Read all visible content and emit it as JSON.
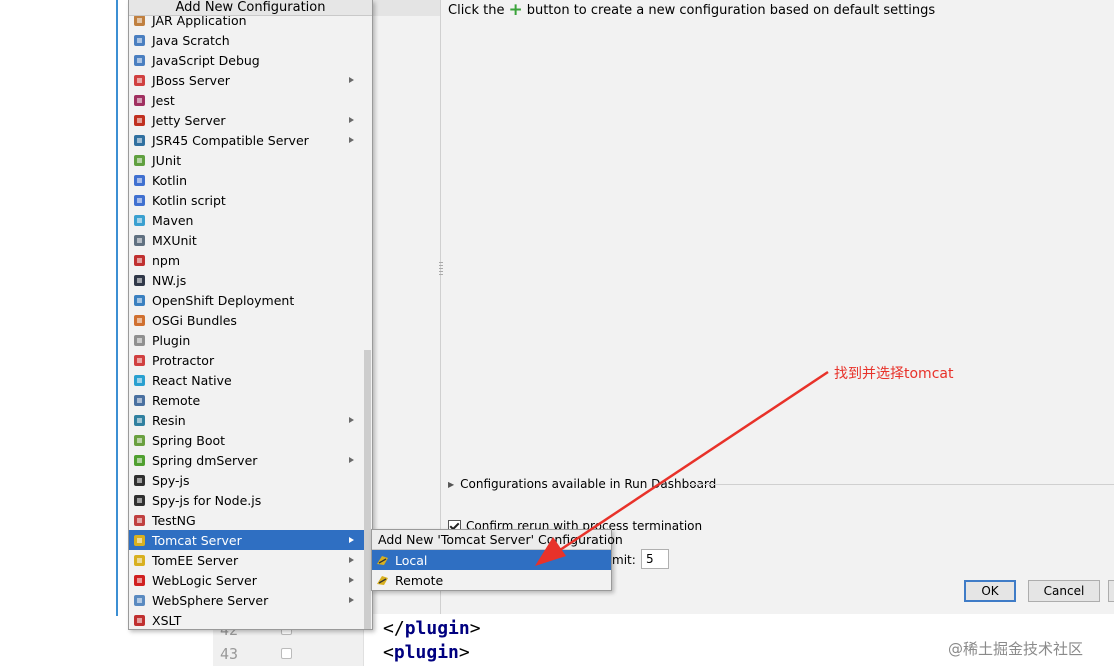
{
  "popup": {
    "title": "Add New Configuration",
    "items": [
      {
        "label": "JAR Application",
        "icon": "jar-icon",
        "color": "#c08040",
        "submenu": false
      },
      {
        "label": "Java Scratch",
        "icon": "scratch-icon",
        "color": "#4a7fc0",
        "submenu": false
      },
      {
        "label": "JavaScript Debug",
        "icon": "js-debug-icon",
        "color": "#4a7fc0",
        "submenu": false
      },
      {
        "label": "JBoss Server",
        "icon": "jboss-icon",
        "color": "#d04040",
        "submenu": true
      },
      {
        "label": "Jest",
        "icon": "jest-icon",
        "color": "#a03060",
        "submenu": false
      },
      {
        "label": "Jetty Server",
        "icon": "jetty-icon",
        "color": "#c03020",
        "submenu": true
      },
      {
        "label": "JSR45 Compatible Server",
        "icon": "jsr45-icon",
        "color": "#3070a0",
        "submenu": true
      },
      {
        "label": "JUnit",
        "icon": "junit-icon",
        "color": "#60a040",
        "submenu": false
      },
      {
        "label": "Kotlin",
        "icon": "kotlin-icon",
        "color": "#4070d0",
        "submenu": false
      },
      {
        "label": "Kotlin script",
        "icon": "kotlin-script-icon",
        "color": "#4070d0",
        "submenu": false
      },
      {
        "label": "Maven",
        "icon": "maven-icon",
        "color": "#3aa0d0",
        "submenu": false
      },
      {
        "label": "MXUnit",
        "icon": "mxunit-icon",
        "color": "#607080",
        "submenu": false
      },
      {
        "label": "npm",
        "icon": "npm-icon",
        "color": "#c03030",
        "submenu": false
      },
      {
        "label": "NW.js",
        "icon": "nwjs-icon",
        "color": "#303848",
        "submenu": false
      },
      {
        "label": "OpenShift Deployment",
        "icon": "openshift-icon",
        "color": "#3a80c0",
        "submenu": false
      },
      {
        "label": "OSGi Bundles",
        "icon": "osgi-icon",
        "color": "#d07030",
        "submenu": false
      },
      {
        "label": "Plugin",
        "icon": "plugin-icon",
        "color": "#909090",
        "submenu": false
      },
      {
        "label": "Protractor",
        "icon": "protractor-icon",
        "color": "#d04040",
        "submenu": false
      },
      {
        "label": "React Native",
        "icon": "react-icon",
        "color": "#2aa0d0",
        "submenu": false
      },
      {
        "label": "Remote",
        "icon": "remote-icon",
        "color": "#4a70a0",
        "submenu": false
      },
      {
        "label": "Resin",
        "icon": "resin-icon",
        "color": "#3080a0",
        "submenu": true
      },
      {
        "label": "Spring Boot",
        "icon": "spring-boot-icon",
        "color": "#6aa040",
        "submenu": false
      },
      {
        "label": "Spring dmServer",
        "icon": "spring-dm-icon",
        "color": "#50a030",
        "submenu": true
      },
      {
        "label": "Spy-js",
        "icon": "spyjs-icon",
        "color": "#303030",
        "submenu": false
      },
      {
        "label": "Spy-js for Node.js",
        "icon": "spyjs-node-icon",
        "color": "#303030",
        "submenu": false
      },
      {
        "label": "TestNG",
        "icon": "testng-icon",
        "color": "#c04040",
        "submenu": false
      },
      {
        "label": "Tomcat Server",
        "icon": "tomcat-icon",
        "color": "#d8b020",
        "submenu": true,
        "selected": true
      },
      {
        "label": "TomEE Server",
        "icon": "tomee-icon",
        "color": "#d8b020",
        "submenu": true
      },
      {
        "label": "WebLogic Server",
        "icon": "weblogic-icon",
        "color": "#d02020",
        "submenu": true
      },
      {
        "label": "WebSphere Server",
        "icon": "websphere-icon",
        "color": "#5a8ac0",
        "submenu": true
      },
      {
        "label": "XSLT",
        "icon": "xslt-icon",
        "color": "#c03030",
        "submenu": false
      }
    ]
  },
  "submenu": {
    "title": "Add New 'Tomcat Server' Configuration",
    "items": [
      {
        "label": "Local",
        "icon": "tomcat-local-icon",
        "selected": true
      },
      {
        "label": "Remote",
        "icon": "tomcat-remote-icon"
      }
    ]
  },
  "panel": {
    "hint_before": "Click the",
    "hint_plus": "+",
    "hint_after": "button to create a new configuration based on default settings",
    "run_dashboard": "Configurations available in Run Dashboard",
    "confirm_rerun": "Confirm rerun with process termination",
    "limit_label": "mit:",
    "limit_value": "5",
    "ok": "OK",
    "cancel": "Cancel"
  },
  "editor": {
    "line42": "42",
    "line43": "43",
    "code1_open": "</",
    "code1_tag": "plugin",
    "code1_close": ">",
    "code2_open": "<",
    "code2_tag": "plugin",
    "code2_close": ">"
  },
  "annotation": {
    "text": "找到并选择tomcat",
    "color": "#e8322a"
  },
  "watermark": "@稀土掘金技术社区",
  "colors": {
    "selection": "#2f6fc2",
    "accent_line": "#3c8fd3"
  }
}
